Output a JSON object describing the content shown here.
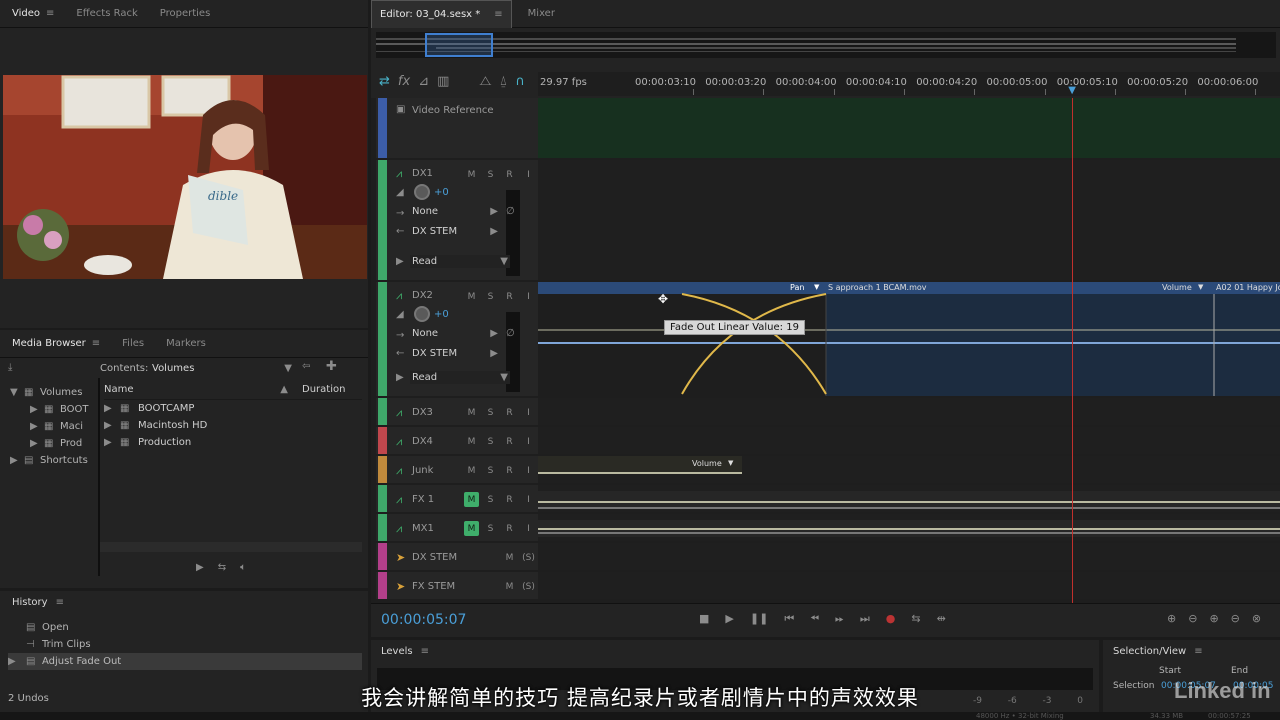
{
  "left_tabs": {
    "video": "Video",
    "effects": "Effects Rack",
    "properties": "Properties",
    "menu": "≡"
  },
  "media_tabs": {
    "browser": "Media Browser",
    "files": "Files",
    "markers": "Markers",
    "menu": "≡"
  },
  "media": {
    "contents_label": "Contents:",
    "contents_value": "Volumes",
    "tree": [
      "Volumes",
      "BOOTCAMP",
      "Macintosh HD",
      "Production",
      "Shortcuts"
    ],
    "tree_short": [
      "Volumes",
      "BOOT",
      "Maci",
      "Prod",
      "Shortcuts"
    ],
    "col_name": "Name",
    "col_duration": "Duration",
    "files": [
      "BOOTCAMP",
      "Macintosh HD",
      "Production"
    ]
  },
  "history": {
    "title": "History",
    "menu": "≡",
    "items": [
      "Open",
      "Trim Clips",
      "Adjust Fade Out"
    ],
    "undos": "2 Undos"
  },
  "editor": {
    "tab": "Editor: 03_04.sesx *",
    "menu": "≡",
    "mixer": "Mixer"
  },
  "ruler": {
    "fps": "29.97 fps",
    "ticks": [
      "00:00:03:10",
      "00:00:03:20",
      "00:00:04:00",
      "00:00:04:10",
      "00:00:04:20",
      "00:00:05:00",
      "00:00:05:10",
      "00:00:05:20",
      "00:00:06:00"
    ],
    "playhead_fraction": 0.72
  },
  "video_ref": "Video Reference",
  "tracks": [
    {
      "name": "DX1",
      "color": "#3fa86a",
      "m": "M",
      "s": "S",
      "r": "R",
      "i": "I",
      "vol": "+0",
      "input": "None",
      "output": "DX STEM",
      "mode": "Read"
    },
    {
      "name": "DX2",
      "color": "#3fa86a",
      "m": "M",
      "s": "S",
      "r": "R",
      "i": "I",
      "vol": "+0",
      "input": "None",
      "output": "DX STEM",
      "mode": "Read"
    },
    {
      "name": "DX3",
      "color": "#3fa86a",
      "m": "M",
      "s": "S",
      "r": "R",
      "i": "I"
    },
    {
      "name": "DX4",
      "color": "#c0474d",
      "m": "M",
      "s": "S",
      "r": "R",
      "i": "I"
    },
    {
      "name": "Junk",
      "color": "#c08a3c",
      "m": "M",
      "s": "S",
      "r": "R",
      "i": "I"
    },
    {
      "name": "FX 1",
      "color": "#3fa86a",
      "m": "M",
      "s": "S",
      "r": "R",
      "i": "I",
      "muted": true
    },
    {
      "name": "MX1",
      "color": "#3fa86a",
      "m": "M",
      "s": "S",
      "r": "R",
      "i": "I",
      "muted": true
    },
    {
      "name": "DX STEM",
      "color": "#b33f8a",
      "m": "M",
      "s": "(S)"
    },
    {
      "name": "FX STEM",
      "color": "#b33f8a",
      "m": "M",
      "s": "(S)"
    }
  ],
  "clips": {
    "pan": "Pan",
    "clip1": "S approach 1 BCAM.mov",
    "volume": "Volume",
    "clip2": "A02 01 Happy Jo",
    "junk_volume": "Volume",
    "tooltip": "Fade Out Linear Value: 19"
  },
  "transport": {
    "time": "00:00:05:07"
  },
  "levels": {
    "title": "Levels",
    "menu": "≡",
    "scale": [
      "-9",
      "-6",
      "-3",
      "0"
    ]
  },
  "selection": {
    "title": "Selection/View",
    "menu": "≡",
    "start": "Start",
    "end": "End",
    "row": "Selection",
    "start_val": "00:00:05:07",
    "end_val": "00:00:05"
  },
  "subtitle": "我会讲解简单的技巧 提高纪录片或者剧情片中的声效效果",
  "watermark": "Linked in",
  "status": {
    "a": "48000 Hz • 32-bit Mixing",
    "b": "34.33 MB",
    "c": "00:00:57:25"
  }
}
